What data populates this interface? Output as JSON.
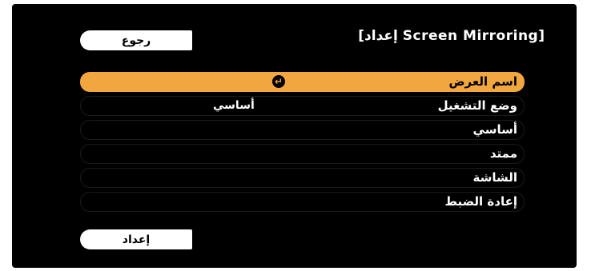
{
  "window": {
    "title": "[إعداد Screen Mirroring]"
  },
  "buttons": {
    "back_label": "رجوع",
    "setup_label": "إعداد"
  },
  "menu": {
    "items": [
      {
        "label": "اسم العرض",
        "value": "",
        "selected": true,
        "icon": "enter-icon"
      },
      {
        "label": "وضع التشغيل",
        "value": "أساسي",
        "selected": false
      },
      {
        "label": "أساسي",
        "value": "",
        "selected": false
      },
      {
        "label": "ممتد",
        "value": "",
        "selected": false
      },
      {
        "label": "الشاشة",
        "value": "",
        "selected": false
      },
      {
        "label": "إعادة الضبط",
        "value": "",
        "selected": false
      }
    ]
  },
  "colors": {
    "background": "#000000",
    "highlight": "#f2a640",
    "text": "#ffffff"
  },
  "icons": {
    "enter_glyph": "↵"
  }
}
